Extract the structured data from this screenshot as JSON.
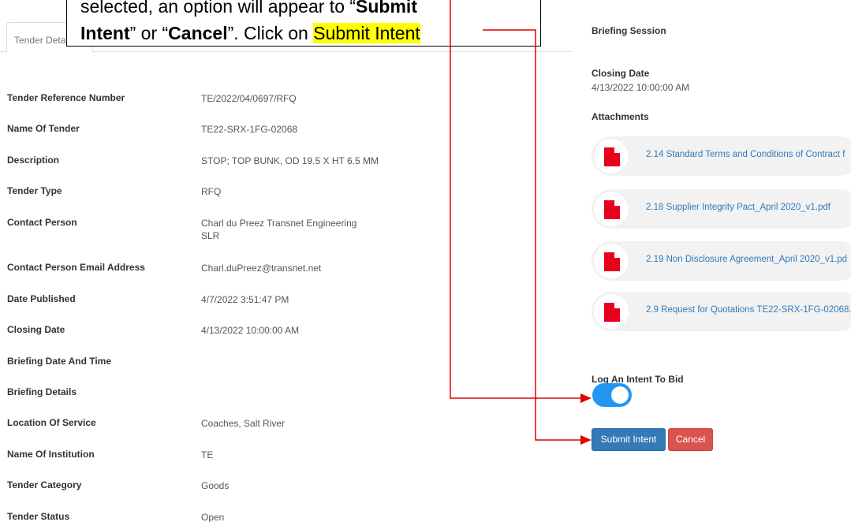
{
  "tabs": [
    {
      "label": "Tender Details"
    }
  ],
  "callout": {
    "line1": "selected, an option will appear to “",
    "line1_bold": "Submit",
    "line2_bold_a": "Intent",
    "line2_mid": "” or “",
    "line2_bold_b": "Cancel",
    "line2_end": "”. Click on ",
    "line2_highlight": "Submit Intent"
  },
  "details": [
    {
      "label": "Tender Reference Number",
      "value": "TE/2022/04/0697/RFQ"
    },
    {
      "label": "Name Of Tender",
      "value": "TE22-SRX-1FG-02068"
    },
    {
      "label": "Description",
      "value": "STOP; TOP BUNK, OD 19.5 X HT 6.5 MM"
    },
    {
      "label": "Tender Type",
      "value": "RFQ"
    },
    {
      "label": "Contact Person",
      "value": "Charl du Preez Transnet Engineering SLR"
    },
    {
      "label": "Contact Person Email Address",
      "value": "Charl.duPreez@transnet.net"
    },
    {
      "label": "Date Published",
      "value": "4/7/2022 3:51:47 PM"
    },
    {
      "label": "Closing Date",
      "value": "4/13/2022 10:00:00 AM"
    },
    {
      "label": "Briefing Date And Time",
      "value": ""
    },
    {
      "label": "Briefing Details",
      "value": ""
    },
    {
      "label": "Location Of Service",
      "value": "Coaches, Salt River"
    },
    {
      "label": "Name Of Institution",
      "value": "TE"
    },
    {
      "label": "Tender Category",
      "value": "Goods"
    },
    {
      "label": "Tender Status",
      "value": "Open"
    }
  ],
  "side": {
    "briefing_session": "Briefing Session",
    "closing_date_label": "Closing Date",
    "closing_date_value": "4/13/2022 10:00:00 AM",
    "attachments_label": "Attachments",
    "attachments": [
      {
        "name": "2.14 Standard Terms and Conditions of Contract f"
      },
      {
        "name": "2.18 Supplier Integrity Pact_April 2020_v1.pdf"
      },
      {
        "name": "2.19 Non Disclosure Agreement_April 2020_v1.pd"
      },
      {
        "name": "2.9 Request for Quotations TE22-SRX-1FG-02068."
      }
    ],
    "intent_label": "Log An Intent To Bid",
    "intent_on": true,
    "submit_label": "Submit Intent",
    "cancel_label": "Cancel"
  },
  "colors": {
    "primary": "#337ab7",
    "danger": "#d9534f",
    "toggle": "#2196F3",
    "pdf": "#e8001c",
    "arrow": "#e00000",
    "highlight": "#ffff00"
  }
}
